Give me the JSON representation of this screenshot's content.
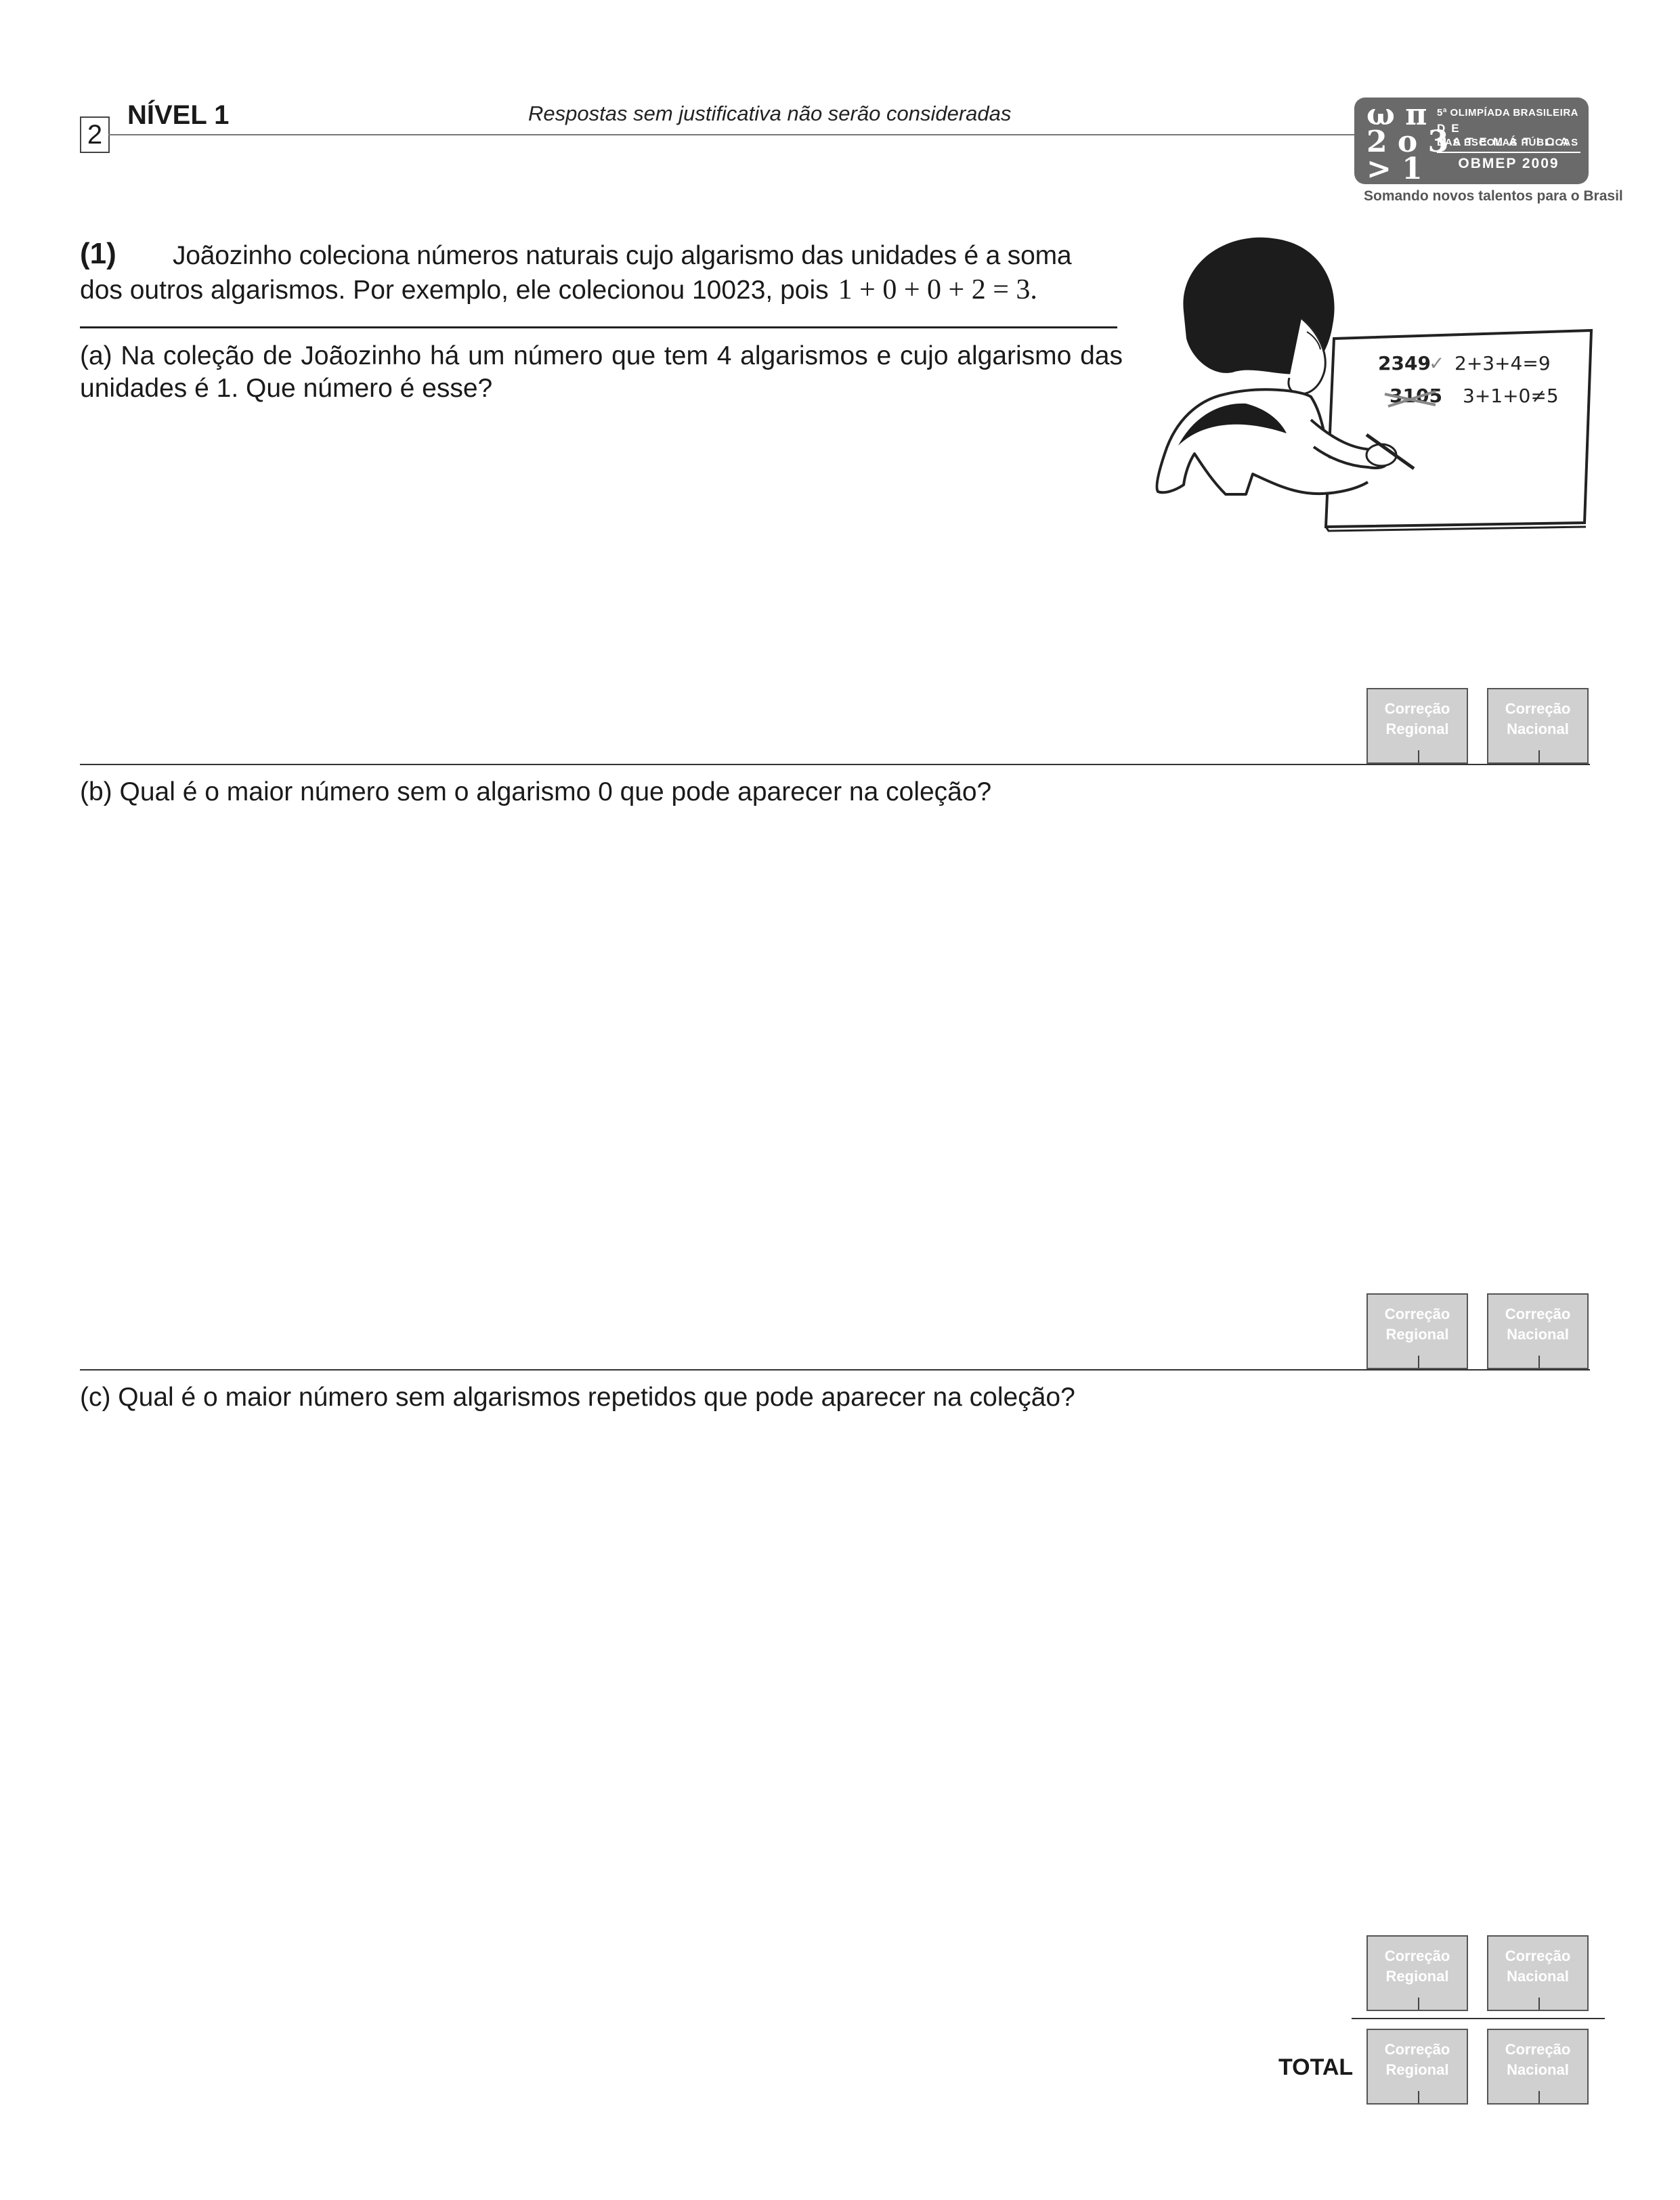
{
  "header": {
    "page_number": "2",
    "level": "NÍVEL 1",
    "subtitle": "Respostas sem justificativa não serão consideradas"
  },
  "logo": {
    "glyphs": "ω π\n2 o 3\n> 1",
    "line1": "5ª OLIMPÍADA BRASILEIRA",
    "line2": "DE MATEMÁTICA",
    "line3": "DAS ESCOLAS PÚBLICAS",
    "line4": "OBMEP 2009",
    "tagline": "Somando novos talentos para o Brasil"
  },
  "problem": {
    "number": "(1)",
    "intro_line1": "Joãozinho coleciona números naturais cujo algarismo das unidades é a soma",
    "intro_line2": "dos outros algarismos. Por exemplo, ele colecionou 10023, pois",
    "intro_equation": "1 + 0 + 0 + 2 = 3.",
    "question_a": "(a) Na coleção de Joãozinho há um número que tem 4 algarismos e cujo algarismo das unidades é 1. Que número é esse?",
    "question_b": "(b) Qual é o maior número sem o algarismo 0 que pode aparecer na coleção?",
    "question_c": "(c) Qual é o maior número sem algarismos repetidos que pode aparecer na coleção?"
  },
  "illustration": {
    "board_line1_number": "2349",
    "board_line1_check": "✓",
    "board_line1_sum": "2+3+4=9",
    "board_line2_number": "3105",
    "board_line2_sum": "3+1+0≠5"
  },
  "grading": {
    "regional_line1": "Correção",
    "regional_line2": "Regional",
    "nacional_line1": "Correção",
    "nacional_line2": "Nacional",
    "total_label": "TOTAL"
  }
}
